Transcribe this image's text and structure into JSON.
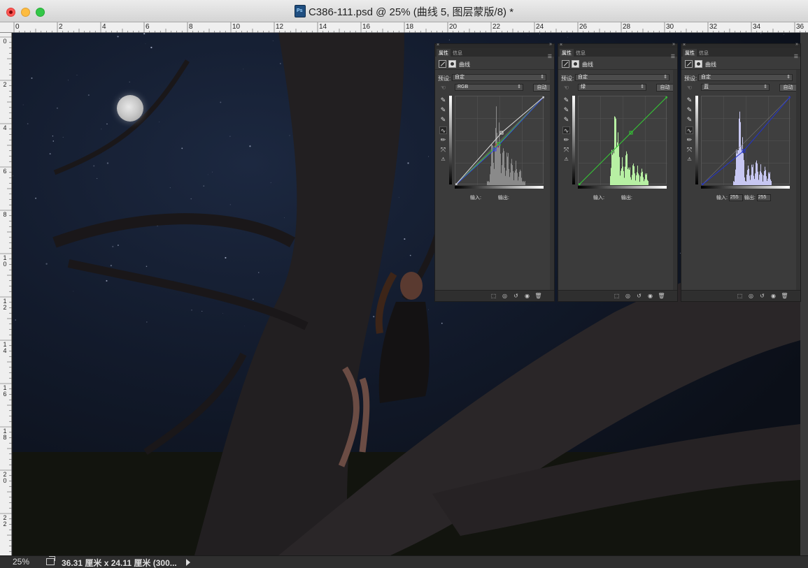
{
  "window": {
    "title": "C386-111.psd @ 25% (曲线 5, 图层蒙版/8) *"
  },
  "ruler": {
    "top_ticks": [
      "0",
      "2",
      "4",
      "6",
      "8",
      "10",
      "12",
      "14",
      "16",
      "18",
      "20",
      "22",
      "24",
      "26",
      "28",
      "30",
      "32",
      "34",
      "36"
    ],
    "left_ticks": [
      "0",
      "2",
      "4",
      "6",
      "8",
      "1\n0",
      "1\n2",
      "1\n4",
      "1\n6",
      "1\n8",
      "2\n0",
      "2\n2"
    ]
  },
  "status": {
    "zoom": "25%",
    "doc_size": "36.31 厘米 x 24.11 厘米 (300..."
  },
  "panels": [
    {
      "tab_properties": "属性",
      "tab_info": "信息",
      "header_label": "曲线",
      "preset_label": "预设:",
      "preset_value": "自定",
      "channel_value": "RGB",
      "auto_label": "自动",
      "input_label": "输入:",
      "output_label": "输出:",
      "input_value": "",
      "output_value": "",
      "curve_color": "#dddddd"
    },
    {
      "tab_properties": "属性",
      "tab_info": "信息",
      "header_label": "曲线",
      "preset_label": "预设:",
      "preset_value": "自定",
      "channel_value": "绿",
      "auto_label": "自动",
      "input_label": "输入:",
      "output_label": "输出:",
      "input_value": "",
      "output_value": "",
      "curve_color": "#33cc33"
    },
    {
      "tab_properties": "属性",
      "tab_info": "信息",
      "header_label": "曲线",
      "preset_label": "预设:",
      "preset_value": "自定",
      "channel_value": "蓝",
      "auto_label": "自动",
      "input_label": "输入:",
      "output_label": "输出:",
      "input_value": "255",
      "output_value": "255",
      "curve_color": "#2233cc"
    }
  ]
}
